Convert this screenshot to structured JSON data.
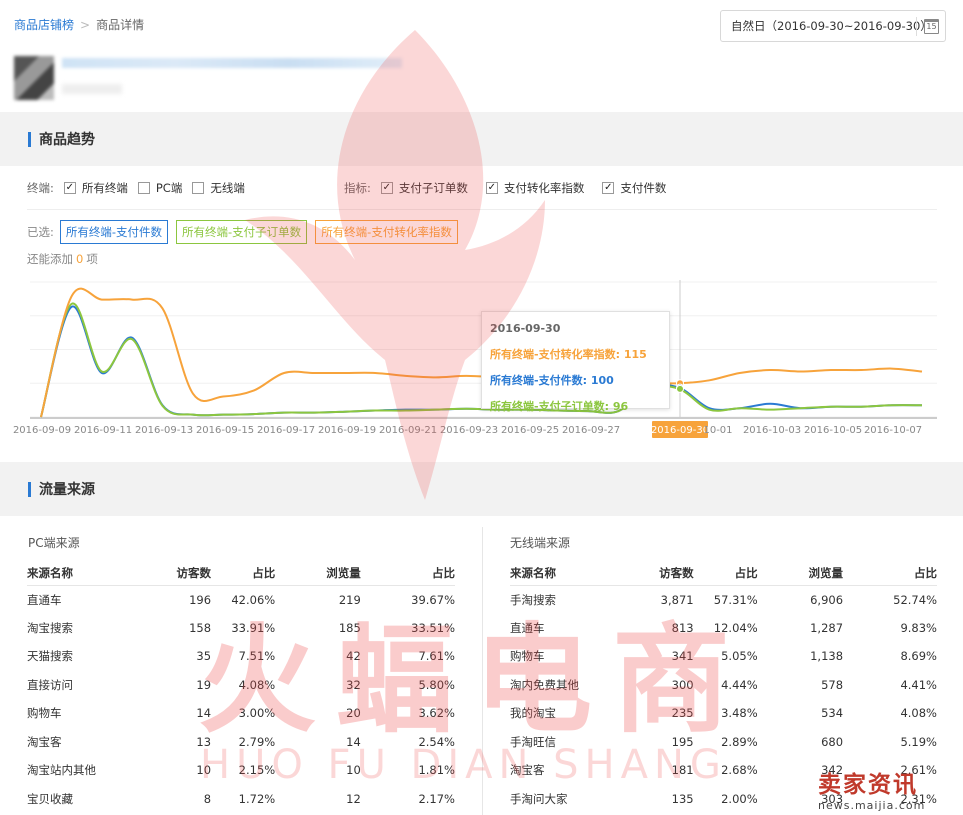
{
  "breadcrumb": {
    "parent": "商品店铺榜",
    "current": "商品详情"
  },
  "date_range": "自然日（2016-09-30~2016-09-30）",
  "calendar_icon_text": "15",
  "sections": {
    "trend": "商品趋势",
    "traffic": "流量来源"
  },
  "filters": {
    "terminal_label": "终端:",
    "terminals": [
      {
        "label": "所有终端",
        "checked": true
      },
      {
        "label": "PC端",
        "checked": false
      },
      {
        "label": "无线端",
        "checked": false
      }
    ],
    "metric_label": "指标:",
    "metrics": [
      {
        "label": "支付子订单数",
        "checked": true
      },
      {
        "label": "支付转化率指数",
        "checked": true
      },
      {
        "label": "支付件数",
        "checked": true
      }
    ]
  },
  "selected": {
    "label": "已选:",
    "tags": [
      {
        "label": "所有终端-支付件数",
        "color": "#2a7ad3"
      },
      {
        "label": "所有终端-支付子订单数",
        "color": "#8cc63f"
      },
      {
        "label": "所有终端-支付转化率指数",
        "color": "#f7a33b"
      }
    ],
    "addable_prefix": "还能添加",
    "addable_count": "0",
    "addable_suffix": "项"
  },
  "chart_data": {
    "type": "line",
    "x": [
      "2016-09-09",
      "2016-09-10",
      "2016-09-11",
      "2016-09-12",
      "2016-09-13",
      "2016-09-14",
      "2016-09-15",
      "2016-09-16",
      "2016-09-17",
      "2016-09-18",
      "2016-09-19",
      "2016-09-20",
      "2016-09-21",
      "2016-09-22",
      "2016-09-23",
      "2016-09-24",
      "2016-09-25",
      "2016-09-26",
      "2016-09-27",
      "2016-09-28",
      "2016-09-29",
      "2016-09-30",
      "2016-10-01",
      "2016-10-02",
      "2016-10-03",
      "2016-10-04",
      "2016-10-05",
      "2016-10-06",
      "2016-10-07",
      "2016-10-08"
    ],
    "x_tick_labels": [
      "2016-09-09",
      "2016-09-11",
      "2016-09-13",
      "2016-09-15",
      "2016-09-17",
      "2016-09-19",
      "2016-09-21",
      "2016-09-23",
      "2016-09-25",
      "2016-09-27",
      "2016-09-30",
      "10-01",
      "2016-10-03",
      "2016-10-05",
      "2016-10-07"
    ],
    "highlight_x": "2016-09-30",
    "ylim": [
      0,
      460
    ],
    "series": [
      {
        "name": "所有终端-支付转化率指数",
        "color": "#f7a33b",
        "values": [
          0,
          410,
          400,
          400,
          370,
          80,
          70,
          90,
          150,
          150,
          150,
          150,
          140,
          135,
          140,
          135,
          130,
          128,
          120,
          118,
          116,
          115,
          125,
          150,
          160,
          155,
          160,
          160,
          165,
          155
        ]
      },
      {
        "name": "所有终端-支付件数",
        "color": "#2a7ad3",
        "values": [
          0,
          375,
          150,
          270,
          40,
          8,
          8,
          10,
          15,
          15,
          18,
          22,
          25,
          25,
          28,
          25,
          25,
          22,
          20,
          20,
          100,
          100,
          30,
          30,
          45,
          30,
          35,
          35,
          40,
          40
        ]
      },
      {
        "name": "所有终端-支付子订单数",
        "color": "#8cc63f",
        "values": [
          0,
          385,
          155,
          265,
          38,
          8,
          8,
          10,
          15,
          15,
          18,
          22,
          22,
          25,
          28,
          25,
          25,
          22,
          20,
          20,
          96,
          96,
          25,
          30,
          25,
          30,
          35,
          35,
          40,
          40
        ]
      }
    ],
    "tooltip": {
      "date": "2016-09-30",
      "rows": [
        {
          "label": "所有终端-支付转化率指数:",
          "value": "115",
          "color": "#f7a33b"
        },
        {
          "label": "所有终端-支付件数:",
          "value": "100",
          "color": "#2a7ad3"
        },
        {
          "label": "所有终端-支付子订单数:",
          "value": "96",
          "color": "#8cc63f"
        }
      ]
    }
  },
  "pc": {
    "title": "PC端来源",
    "headers": [
      "来源名称",
      "访客数",
      "占比",
      "浏览量",
      "占比"
    ],
    "rows": [
      [
        "直通车",
        "196",
        "42.06%",
        "219",
        "39.67%"
      ],
      [
        "淘宝搜索",
        "158",
        "33.91%",
        "185",
        "33.51%"
      ],
      [
        "天猫搜索",
        "35",
        "7.51%",
        "42",
        "7.61%"
      ],
      [
        "直接访问",
        "19",
        "4.08%",
        "32",
        "5.80%"
      ],
      [
        "购物车",
        "14",
        "3.00%",
        "20",
        "3.62%"
      ],
      [
        "淘宝客",
        "13",
        "2.79%",
        "14",
        "2.54%"
      ],
      [
        "淘宝站内其他",
        "10",
        "2.15%",
        "10",
        "1.81%"
      ],
      [
        "宝贝收藏",
        "8",
        "1.72%",
        "12",
        "2.17%"
      ]
    ]
  },
  "mobile": {
    "title": "无线端来源",
    "headers": [
      "来源名称",
      "访客数",
      "占比",
      "浏览量",
      "占比"
    ],
    "rows": [
      [
        "手淘搜索",
        "3,871",
        "57.31%",
        "6,906",
        "52.74%"
      ],
      [
        "直通车",
        "813",
        "12.04%",
        "1,287",
        "9.83%"
      ],
      [
        "购物车",
        "341",
        "5.05%",
        "1,138",
        "8.69%"
      ],
      [
        "淘内免费其他",
        "300",
        "4.44%",
        "578",
        "4.41%"
      ],
      [
        "我的淘宝",
        "235",
        "3.48%",
        "534",
        "4.08%"
      ],
      [
        "手淘旺信",
        "195",
        "2.89%",
        "680",
        "5.19%"
      ],
      [
        "淘宝客",
        "181",
        "2.68%",
        "342",
        "2.61%"
      ],
      [
        "手淘问大家",
        "135",
        "2.00%",
        "303",
        "2.31%"
      ]
    ]
  },
  "watermark": {
    "main": "火蝠电商",
    "sub": "HUO FU DIAN SHANG",
    "corner_big": "卖家资讯",
    "corner_small": "news.maijia.com"
  }
}
